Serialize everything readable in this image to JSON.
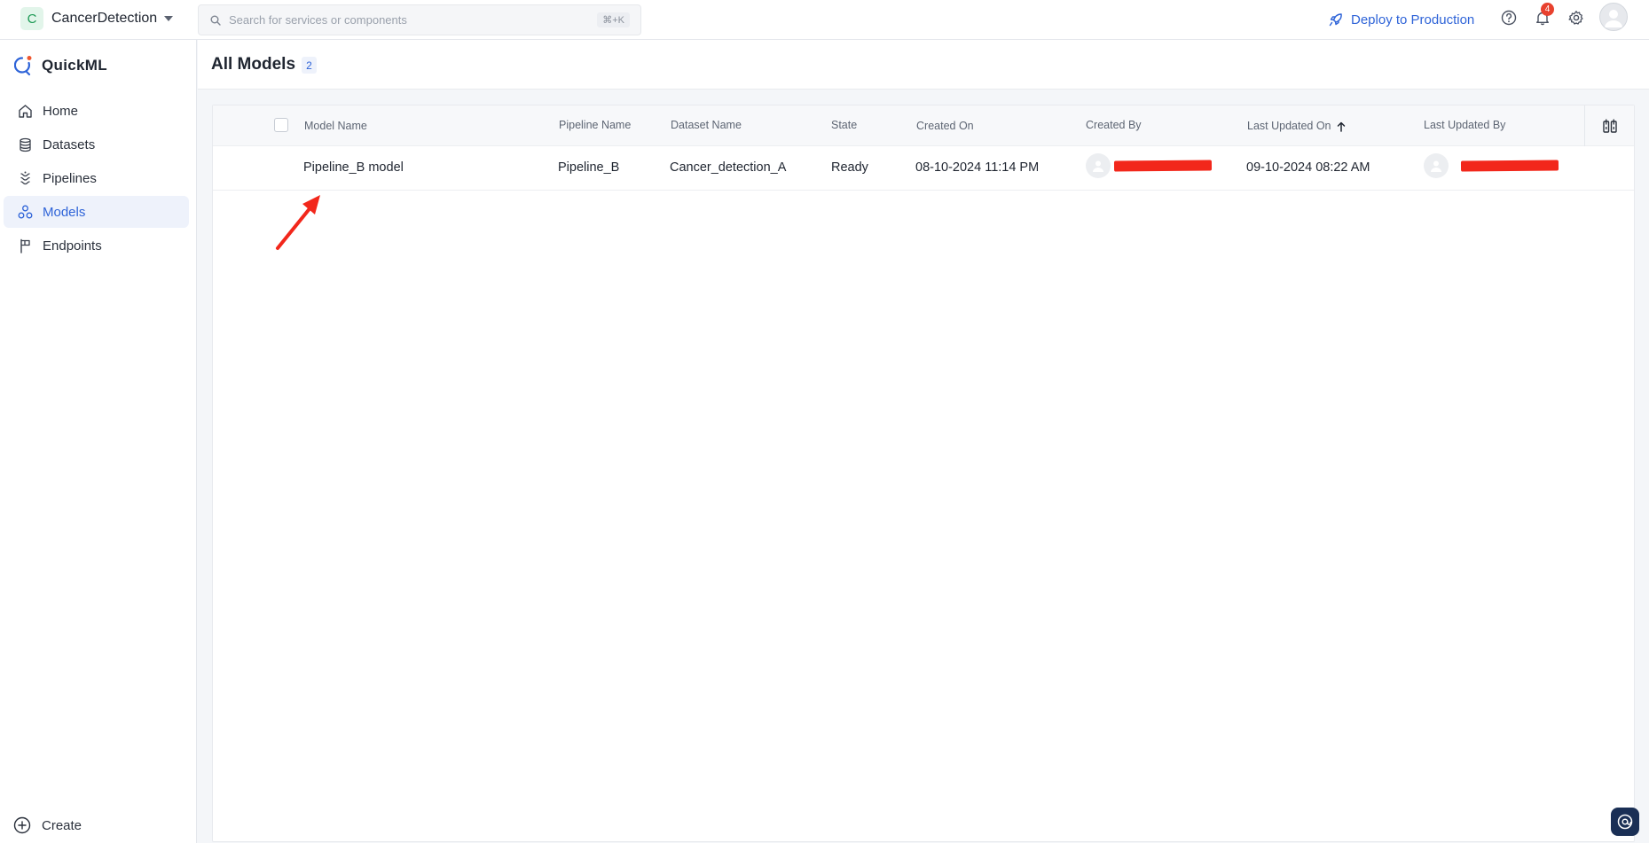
{
  "project": {
    "initial": "C",
    "name": "CancerDetection"
  },
  "search": {
    "placeholder": "Search for services or components",
    "shortcut": "⌘+K"
  },
  "topbar": {
    "deploy_label": "Deploy to Production",
    "notification_count": "4"
  },
  "brand": {
    "name": "QuickML"
  },
  "sidebar": {
    "items": [
      {
        "label": "Home",
        "icon": "home-icon"
      },
      {
        "label": "Datasets",
        "icon": "database-icon"
      },
      {
        "label": "Pipelines",
        "icon": "pipeline-icon"
      },
      {
        "label": "Models",
        "icon": "models-icon",
        "active": true
      },
      {
        "label": "Endpoints",
        "icon": "flag-icon"
      }
    ],
    "create_label": "Create"
  },
  "page": {
    "title": "All Models",
    "count": "2"
  },
  "table": {
    "columns": {
      "model_name": "Model Name",
      "pipeline_name": "Pipeline Name",
      "dataset_name": "Dataset Name",
      "state": "State",
      "created_on": "Created On",
      "created_by": "Created By",
      "last_updated_on": "Last Updated On",
      "last_updated_by": "Last Updated By"
    },
    "sort": {
      "column": "last_updated_on",
      "direction": "ascending"
    },
    "rows": [
      {
        "model_name": "Pipeline_B model",
        "pipeline_name": "Pipeline_B",
        "dataset_name": "Cancer_detection_A",
        "state": "Ready",
        "created_on": "08-10-2024 11:14 PM",
        "last_updated_on": "09-10-2024 08:22 AM"
      }
    ]
  },
  "colors": {
    "accent": "#2f64d8",
    "annotation": "#f2271b",
    "badge": "#e8412e"
  }
}
